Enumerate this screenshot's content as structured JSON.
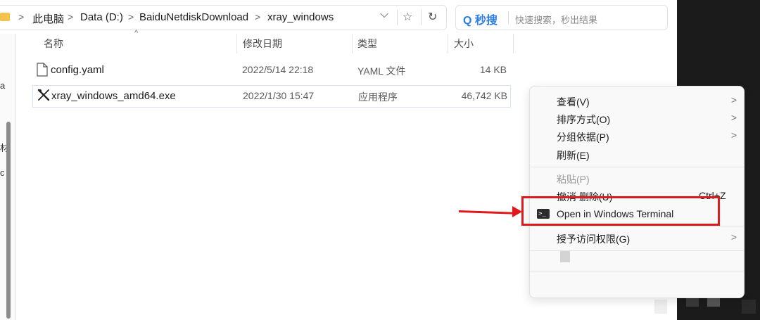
{
  "address_bar": {
    "crumbs": [
      "此电脑",
      "Data (D:)",
      "BaiduNetdiskDownload",
      "xray_windows"
    ],
    "separator": ">",
    "dropdown_glyph": "⌵",
    "favorite_glyph": "☆",
    "refresh_glyph": "↻"
  },
  "search": {
    "brand": "Q 秒搜",
    "placeholder": "快速搜索，秒出结果"
  },
  "columns": {
    "name": "名称",
    "date": "修改日期",
    "type": "类型",
    "size": "大小",
    "sort_caret": "^"
  },
  "files": [
    {
      "name": "config.yaml",
      "date": "2022/5/14 22:18",
      "type": "YAML 文件",
      "size": "14 KB",
      "icon": "document-icon"
    },
    {
      "name": "xray_windows_amd64.exe",
      "date": "2022/1/30 15:47",
      "type": "应用程序",
      "size": "46,742 KB",
      "icon": "exe-icon"
    }
  ],
  "left_strip_chars": [
    "a",
    "材",
    "c"
  ],
  "context_menu": {
    "view": "查看(V)",
    "sort_by": "排序方式(O)",
    "group_by": "分组依据(P)",
    "refresh": "刷新(E)",
    "paste": "粘贴(P)",
    "undo_delete": "撤消 删除(U)",
    "undo_shortcut": "Ctrl+Z",
    "open_terminal": "Open in Windows Terminal",
    "grant_access": "授予访问权限(G)",
    "chevron": ">",
    "terminal_glyph": ">_"
  },
  "colors": {
    "accent_blue": "#2b7de9",
    "annotation_red": "#e0191b",
    "folder_yellow": "#f3c24f"
  }
}
